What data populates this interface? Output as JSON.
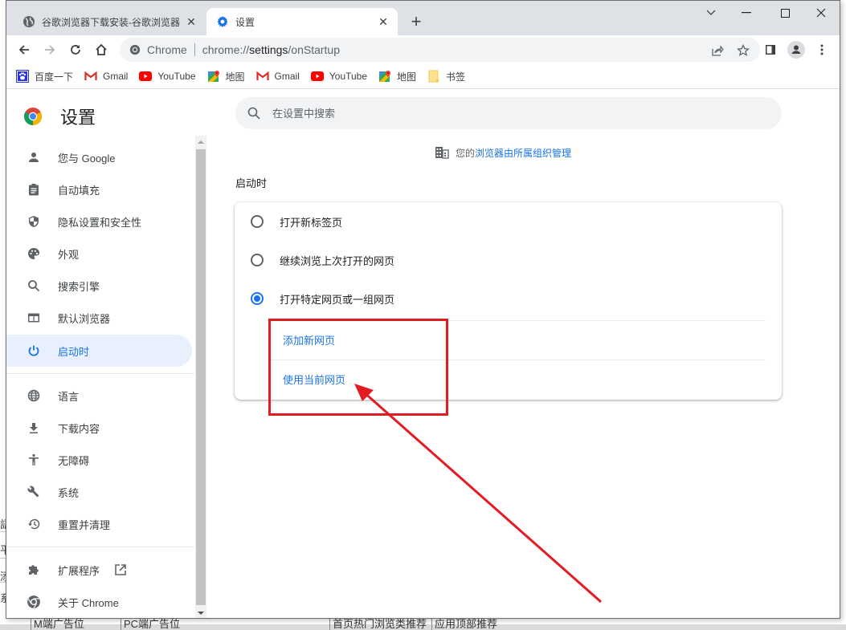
{
  "background": {
    "cells": [
      "M端广告位",
      "PC端广告位",
      "首页热门浏览类推荐",
      "应用顶部推荐"
    ],
    "edge_chars": [
      "語",
      "平",
      "添",
      "系"
    ]
  },
  "tabs": [
    {
      "title": "谷歌浏览器下载安装-谷歌浏览器",
      "icon": "globe-icon",
      "active": false
    },
    {
      "title": "设置",
      "icon": "gear-icon",
      "active": true
    }
  ],
  "window_controls": {
    "tab_search": "chevron-down-icon",
    "minimize": "minimize-icon",
    "maximize": "maximize-icon",
    "close": "close-icon"
  },
  "omnibox": {
    "chip_label": "Chrome",
    "url_prefix": "chrome://",
    "url_host": "settings",
    "url_path": "/onStartup"
  },
  "bookmarks": [
    {
      "label": "百度一下",
      "icon": "baidu-icon"
    },
    {
      "label": "Gmail",
      "icon": "gmail-icon"
    },
    {
      "label": "YouTube",
      "icon": "youtube-icon"
    },
    {
      "label": "地图",
      "icon": "maps-icon"
    },
    {
      "label": "Gmail",
      "icon": "gmail-icon"
    },
    {
      "label": "YouTube",
      "icon": "youtube-icon"
    },
    {
      "label": "地图",
      "icon": "maps-icon"
    },
    {
      "label": "书签",
      "icon": "folder-icon"
    }
  ],
  "settings": {
    "title": "设置",
    "search_placeholder": "在设置中搜索",
    "managed_prefix": "您的",
    "managed_link": "浏览器由所属组织管理",
    "section_title": "启动时",
    "sidebar": [
      {
        "label": "您与 Google",
        "icon": "person-icon"
      },
      {
        "label": "自动填充",
        "icon": "clipboard-icon"
      },
      {
        "label": "隐私设置和安全性",
        "icon": "shield-icon"
      },
      {
        "label": "外观",
        "icon": "palette-icon"
      },
      {
        "label": "搜索引擎",
        "icon": "search-icon"
      },
      {
        "label": "默认浏览器",
        "icon": "browser-icon"
      },
      {
        "label": "启动时",
        "icon": "power-icon",
        "selected": true
      },
      {
        "label": "语言",
        "icon": "globe-icon"
      },
      {
        "label": "下载内容",
        "icon": "download-icon"
      },
      {
        "label": "无障碍",
        "icon": "accessibility-icon"
      },
      {
        "label": "系统",
        "icon": "wrench-icon"
      },
      {
        "label": "重置并清理",
        "icon": "restore-icon"
      },
      {
        "label": "扩展程序",
        "icon": "puzzle-icon",
        "external": true
      },
      {
        "label": "关于 Chrome",
        "icon": "chrome-icon"
      }
    ],
    "startup_options": [
      {
        "label": "打开新标签页",
        "checked": false
      },
      {
        "label": "继续浏览上次打开的网页",
        "checked": false
      },
      {
        "label": "打开特定网页或一组网页",
        "checked": true
      }
    ],
    "links": [
      {
        "label": "添加新网页"
      },
      {
        "label": "使用当前网页"
      }
    ]
  },
  "colors": {
    "accent": "#1a73e8",
    "selected_bg": "#e8f0fe",
    "annotation_red": "#e31b23"
  }
}
